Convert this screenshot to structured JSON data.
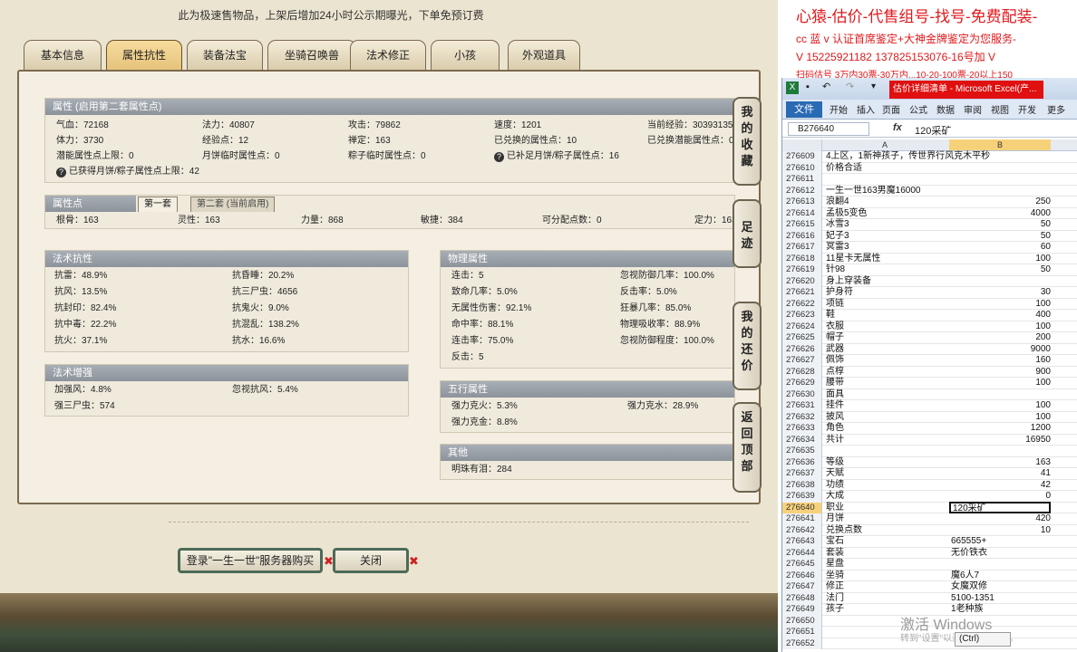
{
  "top_note": "此为极速售物品，上架后增加24小时公示期曝光，下单免预订费",
  "tabs": [
    "基本信息",
    "属性抗性",
    "装备法宝",
    "坐骑召唤兽",
    "法术修正",
    "小孩",
    "外观道具"
  ],
  "active_tab": "属性抗性",
  "attr_panel": {
    "title": "属性 (启用第二套属性点)",
    "rows": [
      [
        "气血：72168",
        "法力：40807",
        "攻击：79862",
        "速度：1201",
        "当前经验：30393135"
      ],
      [
        "体力：3730",
        "经验点：12",
        "禅定：163",
        "已兑换的属性点：10",
        "已兑换潜能属性点：0"
      ],
      [
        "潜能属性点上限：0",
        "月饼临时属性点：0",
        "粽子临时属性点：0",
        "已补足月饼/粽子属性点：16",
        ""
      ]
    ],
    "note": "已获得月饼/粽子属性点上限：42"
  },
  "points_panel": {
    "title": "属性点",
    "subtabs": [
      "第一套",
      "第二套 (当前启用)"
    ],
    "row": [
      "根骨：163",
      "灵性：163",
      "力量：868",
      "敏捷：384",
      "可分配点数：0",
      "定力：163"
    ]
  },
  "magic_resist": {
    "title": "法术抗性",
    "rows": [
      [
        "抗雷：48.9%",
        "抗昏睡：20.2%"
      ],
      [
        "抗风：13.5%",
        "抗三尸虫：4656"
      ],
      [
        "抗封印：82.4%",
        "抗鬼火：9.0%"
      ],
      [
        "抗中毒：22.2%",
        "抗混乱：138.2%"
      ],
      [
        "抗火：37.1%",
        "抗水：16.6%"
      ]
    ]
  },
  "magic_boost": {
    "title": "法术增强",
    "rows": [
      [
        "加强风：4.8%",
        "忽视抗风：5.4%"
      ],
      [
        "强三尸虫：574",
        ""
      ]
    ]
  },
  "physical": {
    "title": "物理属性",
    "rows": [
      [
        "连击：5",
        "忽视防御几率：100.0%"
      ],
      [
        "致命几率：5.0%",
        "反击率：5.0%"
      ],
      [
        "无属性伤害：92.1%",
        "狂暴几率：85.0%"
      ],
      [
        "命中率：88.1%",
        "物理吸收率：88.9%"
      ],
      [
        "连击率：75.0%",
        "忽视防御程度：100.0%"
      ],
      [
        "反击：5",
        ""
      ]
    ]
  },
  "five_elements": {
    "title": "五行属性",
    "rows": [
      [
        "强力克火：5.3%",
        "强力克水：28.9%"
      ],
      [
        "强力克金：8.8%",
        ""
      ]
    ]
  },
  "other": {
    "title": "其他",
    "rows": [
      "明珠有泪：284"
    ]
  },
  "side_buttons": [
    "我的收藏",
    "足迹",
    "我的还价",
    "返回顶部"
  ],
  "bottom_buttons": {
    "login": "登录\"一生一世\"服务器购买",
    "close": "关闭"
  },
  "red_lines": [
    "心猿-估价-代售组号-找号-免费配装-",
    "cc 蓝 v 认证首席鉴定+大神金牌鉴定为您服务-",
    "V 15225921182  137825153076-16号加 V",
    "扫码估号 3万内30票-30万内...10-20-100票-20以上150"
  ],
  "excel": {
    "window_title": "估价详细清单 - Microsoft Excel(产...",
    "ribbon_tabs": [
      "开始",
      "插入",
      "页面",
      "公式",
      "数据",
      "审阅",
      "视图",
      "开发",
      "更多"
    ],
    "file_tab": "文件",
    "name_box": "B276640",
    "formula": "120采矿",
    "col_a": "A",
    "col_b": "B",
    "fx": "fx",
    "rows": [
      [
        "276609",
        "4上区，1新神孩子，传世界行风克木平秒",
        ""
      ],
      [
        "276610",
        "价格合适",
        ""
      ],
      [
        "276611",
        "",
        ""
      ],
      [
        "276612",
        "一生一世163男魔16000",
        ""
      ],
      [
        "276613",
        "浪翻4",
        "250"
      ],
      [
        "276614",
        "孟极5变色",
        "4000"
      ],
      [
        "276615",
        "冰雪3",
        "50"
      ],
      [
        "276616",
        "妃子3",
        "50"
      ],
      [
        "276617",
        "冥雷3",
        "60"
      ],
      [
        "276618",
        "11星卡无属性",
        "100"
      ],
      [
        "276619",
        "针98",
        "50"
      ],
      [
        "276620",
        "身上穿装备",
        ""
      ],
      [
        "276621",
        "护身符",
        "30"
      ],
      [
        "276622",
        "项链",
        "100"
      ],
      [
        "276623",
        "鞋",
        "400"
      ],
      [
        "276624",
        "衣服",
        "100"
      ],
      [
        "276625",
        "帽子",
        "200"
      ],
      [
        "276626",
        "武器",
        "9000"
      ],
      [
        "276627",
        "佩饰",
        "160"
      ],
      [
        "276628",
        "点椁",
        "900"
      ],
      [
        "276629",
        "腰带",
        "100"
      ],
      [
        "276630",
        "面具",
        ""
      ],
      [
        "276631",
        "挂件",
        "100"
      ],
      [
        "276632",
        "披风",
        "100"
      ],
      [
        "276633",
        "角色",
        "1200"
      ],
      [
        "276634",
        "共计",
        "16950"
      ],
      [
        "276635",
        "",
        ""
      ],
      [
        "276636",
        "等级",
        "163"
      ],
      [
        "276637",
        "天赋",
        "41"
      ],
      [
        "276638",
        "功绩",
        "42"
      ],
      [
        "276639",
        "大成",
        "0"
      ],
      [
        "276640",
        "职业",
        "120采矿"
      ],
      [
        "276641",
        "月饼",
        "420"
      ],
      [
        "276642",
        "兑换点数",
        "10"
      ],
      [
        "276643",
        "宝石",
        "665555+"
      ],
      [
        "276644",
        "套装",
        "无价铁衣"
      ],
      [
        "276645",
        "星盘",
        ""
      ],
      [
        "276646",
        "坐骑",
        "魔6人7"
      ],
      [
        "276647",
        "修正",
        "女魔双修"
      ],
      [
        "276648",
        "法门",
        "5100-1351"
      ],
      [
        "276649",
        "孩子",
        "1老种族"
      ],
      [
        "276650",
        "",
        ""
      ],
      [
        "276651",
        "",
        ""
      ],
      [
        "276652",
        "",
        ""
      ]
    ],
    "selected_row": "276640",
    "text_rows": [
      "276609",
      "276610",
      "276612",
      "276640",
      "276643",
      "276644",
      "276646",
      "276647",
      "276648",
      "276649"
    ],
    "watermark": "激活 Windows",
    "watermark2": "转到\"设置\"以激活 Windows。",
    "ctrl_label": "(Ctrl)"
  }
}
